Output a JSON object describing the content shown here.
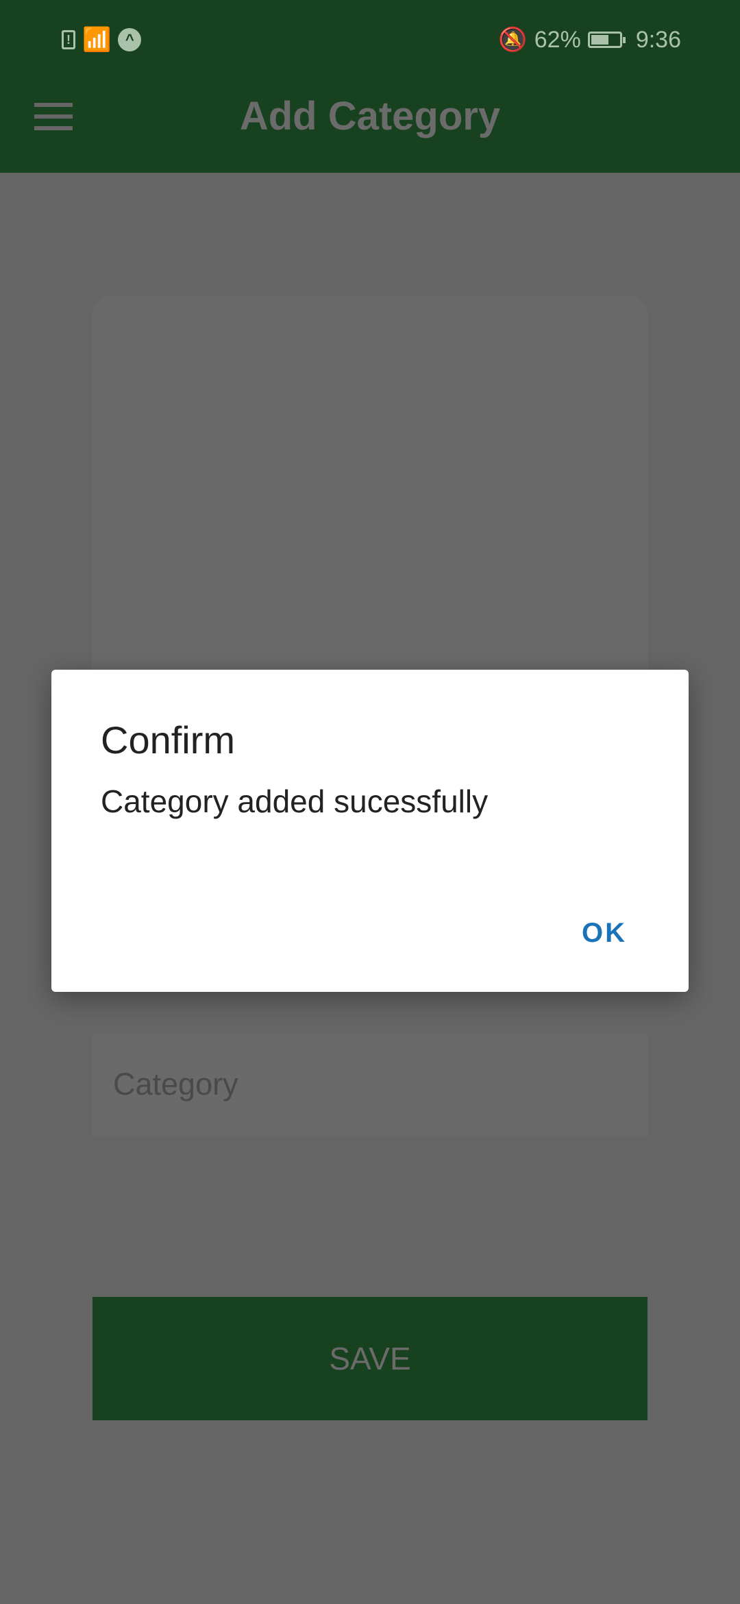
{
  "status_bar": {
    "battery_percent": "62%",
    "battery_level": 0.62,
    "time": "9:36"
  },
  "header": {
    "title": "Add Category"
  },
  "form": {
    "category_placeholder": "Category",
    "save_label": "SAVE"
  },
  "dialog": {
    "title": "Confirm",
    "message": "Category added sucessfully",
    "ok_label": "OK"
  },
  "colors": {
    "primary": "#18421f",
    "accent": "#1a73b8"
  }
}
